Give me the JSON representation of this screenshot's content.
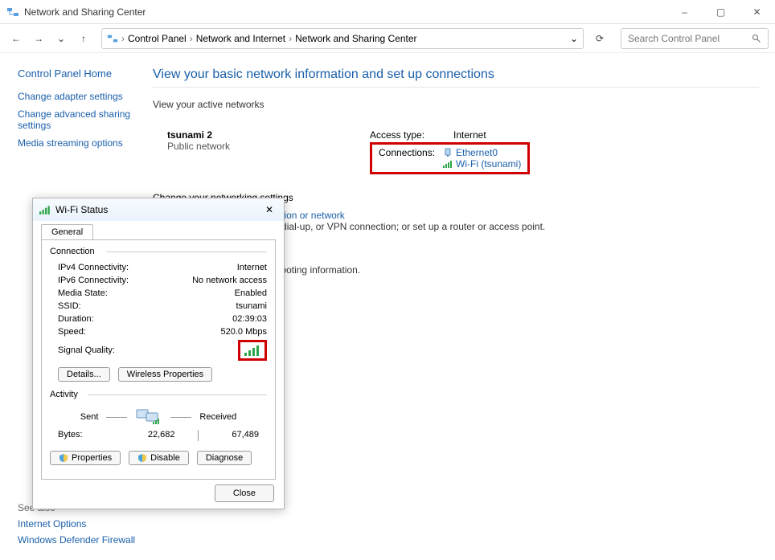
{
  "window": {
    "title": "Network and Sharing Center",
    "minimize": "–",
    "maximize": "▢",
    "close": "✕"
  },
  "toolbar": {
    "back": "←",
    "forward": "→",
    "dropdown": "⌄",
    "up": "↑",
    "refresh": "⟳",
    "search_placeholder": "Search Control Panel",
    "breadcrumb_end_dropdown": "⌄"
  },
  "breadcrumb": {
    "root": "Control Panel",
    "mid": "Network and Internet",
    "leaf": "Network and Sharing Center",
    "sep": "›"
  },
  "sidebar": {
    "home": "Control Panel Home",
    "items": [
      "Change adapter settings",
      "Change advanced sharing settings",
      "Media streaming options"
    ]
  },
  "main": {
    "title": "View your basic network information and set up connections",
    "active_networks_label": "View your active networks",
    "network": {
      "name": "tsunami 2",
      "type": "Public network",
      "access_label": "Access type:",
      "access_value": "Internet",
      "connections_label": "Connections:",
      "conn1": "Ethernet0",
      "conn2": "Wi-Fi (tsunami)"
    },
    "change_settings_label": "Change your networking settings",
    "setup": {
      "link": "Set up a new connection or network",
      "desc": "Set up a broadband, dial-up, or VPN connection; or set up a router or access point."
    },
    "troubleshoot_desc": "ork problems, or get troubleshooting information."
  },
  "see_also": {
    "header": "See also",
    "items": [
      "Internet Options",
      "Windows Defender Firewall"
    ]
  },
  "dialog": {
    "title": "Wi-Fi Status",
    "close": "✕",
    "tab": "General",
    "connection_label": "Connection",
    "rows": {
      "ipv4_k": "IPv4 Connectivity:",
      "ipv4_v": "Internet",
      "ipv6_k": "IPv6 Connectivity:",
      "ipv6_v": "No network access",
      "media_k": "Media State:",
      "media_v": "Enabled",
      "ssid_k": "SSID:",
      "ssid_v": "tsunami",
      "dur_k": "Duration:",
      "dur_v": "02:39:03",
      "speed_k": "Speed:",
      "speed_v": "520.0 Mbps",
      "signal_k": "Signal Quality:"
    },
    "details_btn": "Details...",
    "wireless_btn": "Wireless Properties",
    "activity_label": "Activity",
    "sent": "Sent",
    "received": "Received",
    "bytes_label": "Bytes:",
    "bytes_sent": "22,682",
    "bytes_recv": "67,489",
    "properties_btn": "Properties",
    "disable_btn": "Disable",
    "diagnose_btn": "Diagnose",
    "close_btn": "Close"
  }
}
